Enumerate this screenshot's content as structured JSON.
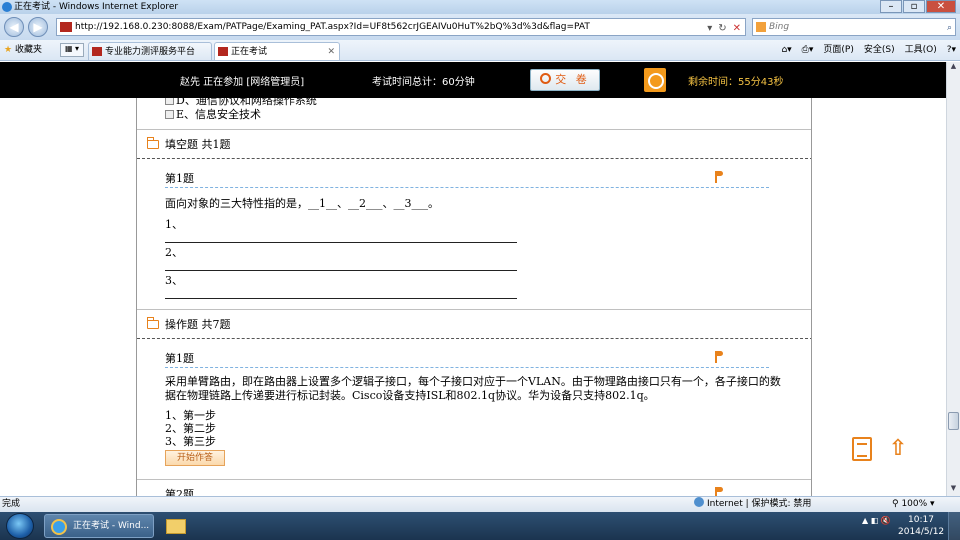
{
  "browser": {
    "window_title": "正在考试 - Windows Internet Explorer",
    "address": "http://192.168.0.230:8088/Exam/PATPage/Examing_PAT.aspx?Id=UF8t562crJGEAIVu0HuT%2bQ%3d%3d&flag=PAT",
    "search_placeholder": "Bing",
    "favorites_label": "收藏夹",
    "tabs": [
      {
        "label": "专业能力测评服务平台"
      },
      {
        "label": "正在考试"
      }
    ],
    "command_bar": [
      "页面(P)",
      "安全(S)",
      "工具(O)"
    ],
    "status_text": "完成",
    "zone_text": "Internet | 保护模式: 禁用",
    "zoom": "100%"
  },
  "exam_header": {
    "user_status": "赵先  正在参加  [网络管理员]",
    "total_time": "考试时间总计：60分钟",
    "submit_label": "交 卷",
    "remaining": "剩余时间：55分43秒"
  },
  "content": {
    "top_options": [
      "D、通信协议和网络操作系统",
      "E、信息安全技术"
    ],
    "sections": [
      {
        "title": "填空题  共1题",
        "question_no": "第1题",
        "question_text": "面向对象的三大特性指的是，__1__、__2___、__3___。",
        "blanks": [
          "1、",
          "2、",
          "3、"
        ]
      },
      {
        "title": "操作题  共7题",
        "question_no": "第1题",
        "question_text": "采用单臂路由，即在路由器上设置多个逻辑子接口，每个子接口对应于一个VLAN。由于物理路由接口只有一个，各子接口的数据在物理链路上传递要进行标记封装。Cisco设备支持ISL和802.1q协议。华为设备只支持802.1q。",
        "steps": [
          "1、第一步",
          "2、第二步",
          "3、第三步"
        ],
        "start_button": "开始作答",
        "next_question_no": "第2题"
      }
    ]
  },
  "taskbar": {
    "ie_task_label": "正在考试 - Wind...",
    "time": "10:17",
    "date": "2014/5/12"
  }
}
